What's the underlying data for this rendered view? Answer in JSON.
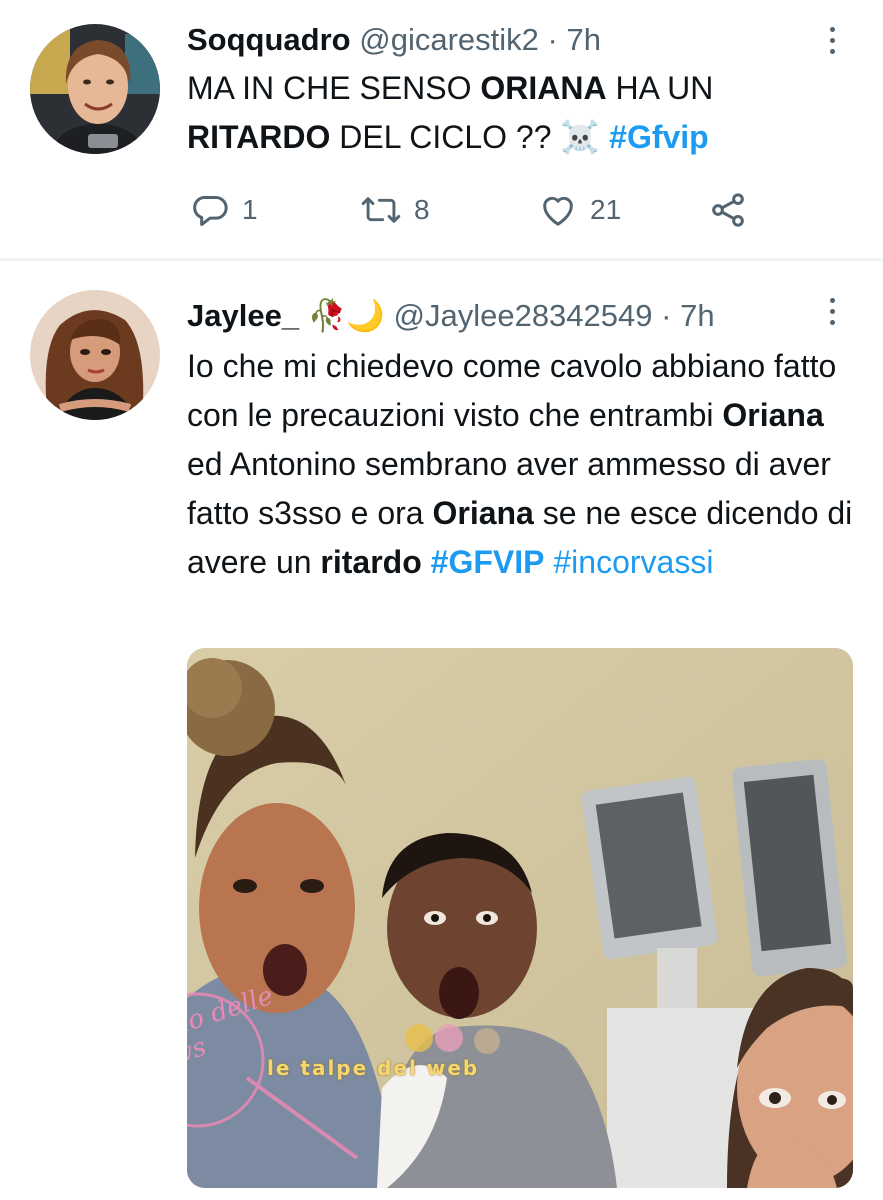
{
  "tweets": [
    {
      "display_name": "Soqquadro",
      "handle": "@gicarestik2",
      "separator": "·",
      "time": "7h",
      "text_parts": [
        {
          "t": "MA IN CHE SENSO ",
          "style": "normal"
        },
        {
          "t": "ORIANA",
          "style": "bold"
        },
        {
          "t": " HA UN ",
          "style": "normal"
        },
        {
          "t": "RITARDO",
          "style": "bold"
        },
        {
          "t": " DEL CICLO ?? ☠️ ",
          "style": "normal"
        },
        {
          "t": "#Gfvip",
          "style": "hashtag-bold"
        }
      ],
      "actions": {
        "replies": "1",
        "retweets": "8",
        "likes": "21"
      }
    },
    {
      "display_name": "Jaylee_ 🥀🌙",
      "handle": "@Jaylee28342549",
      "separator": "·",
      "time": "7h",
      "text_parts": [
        {
          "t": "Io che mi chiedevo come cavolo abbiano fatto con le precauzioni visto che entrambi ",
          "style": "normal"
        },
        {
          "t": "Oriana",
          "style": "bold"
        },
        {
          "t": " ed Antonino sembrano aver ammesso di aver fatto s3sso e ora ",
          "style": "normal"
        },
        {
          "t": "Oriana",
          "style": "bold"
        },
        {
          "t": " se ne esce dicendo di avere un ",
          "style": "normal"
        },
        {
          "t": "ritardo",
          "style": "bold"
        },
        {
          "t": "  ",
          "style": "normal"
        },
        {
          "t": "#GFVIP",
          "style": "hashtag-bold"
        },
        {
          "t": " ",
          "style": "normal"
        },
        {
          "t": "#incorvassi",
          "style": "hashtag"
        }
      ],
      "media": {
        "watermark_1": "Vicolo delle News",
        "watermark_2": "le talpe del web"
      }
    }
  ],
  "icons": {
    "reply": "reply-icon",
    "retweet": "retweet-icon",
    "like": "heart-icon",
    "share": "share-icon",
    "more": "more-dots-icon"
  },
  "colors": {
    "link": "#1d9bf0",
    "secondary": "#536471",
    "text": "#0f1419",
    "divider": "#eff3f4"
  }
}
